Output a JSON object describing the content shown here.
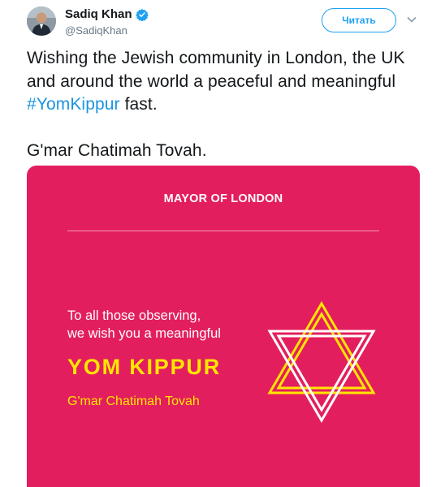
{
  "author": {
    "display_name": "Sadiq Khan",
    "handle": "@SadiqKhan",
    "verified_icon": "verified-badge-icon",
    "avatar": "user-avatar-photo"
  },
  "follow_button": {
    "label": "Читать"
  },
  "menu_icon": "chevron-down-icon",
  "tweet": {
    "text_before_hashtag": "Wishing the Jewish community in London, the UK and around the world a peaceful and meaningful ",
    "hashtag": "#YomKippur",
    "text_after_hashtag": " fast.",
    "second_paragraph": "G'mar Chatimah Tovah."
  },
  "card": {
    "logo_text": "MAYOR OF LONDON",
    "greeting_line_1": "To all those observing,",
    "greeting_line_2": "we wish you a meaningful",
    "headline": "YOM KIPPUR",
    "subline": "G'mar Chatimah Tovah",
    "background_color": "#e31e5e",
    "accent_yellow": "#ffe600",
    "icon": "star-of-david-icon"
  },
  "colors": {
    "link_blue": "#1b95e0",
    "follow_blue": "#1da1f2",
    "text_primary": "#14171a",
    "text_secondary": "#657786"
  }
}
